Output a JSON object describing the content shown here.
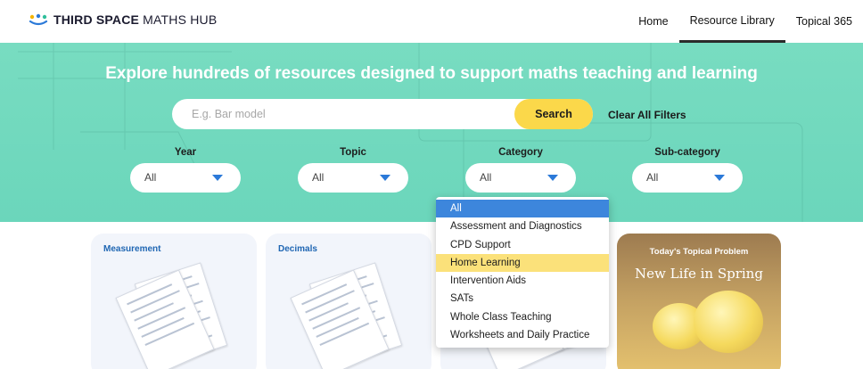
{
  "brand": {
    "name_bold": "THIRD SPACE",
    "name_rest": " MATHS HUB"
  },
  "nav": {
    "items": [
      "Home",
      "Resource Library",
      "Topical 365"
    ],
    "active": "Resource Library"
  },
  "hero": {
    "title": "Explore hundreds of resources designed to support maths teaching and learning",
    "search": {
      "placeholder": "E.g. Bar model",
      "button": "Search"
    },
    "clear_filters": "Clear All Filters",
    "filters": [
      {
        "label": "Year",
        "value": "All"
      },
      {
        "label": "Topic",
        "value": "All"
      },
      {
        "label": "Category",
        "value": "All"
      },
      {
        "label": "Sub-category",
        "value": "All"
      }
    ]
  },
  "category_dropdown": {
    "options": [
      "All",
      "Assessment and Diagnostics",
      "CPD Support",
      "Home Learning",
      "Intervention Aids",
      "SATs",
      "Whole Class Teaching",
      "Worksheets and Daily Practice"
    ],
    "selected": "All",
    "hovered": "Home Learning"
  },
  "cards": [
    {
      "title": "Measurement"
    },
    {
      "title": "Decimals"
    },
    {
      "title": ""
    }
  ],
  "topical": {
    "label": "Today's Topical Problem",
    "title": "New Life in Spring"
  },
  "colors": {
    "hero": "#6bd6bb",
    "accent_blue": "#3d86dc",
    "search_yellow": "#fbd84a",
    "hover_yellow": "#fbe17a",
    "card_title": "#1f66b3"
  }
}
